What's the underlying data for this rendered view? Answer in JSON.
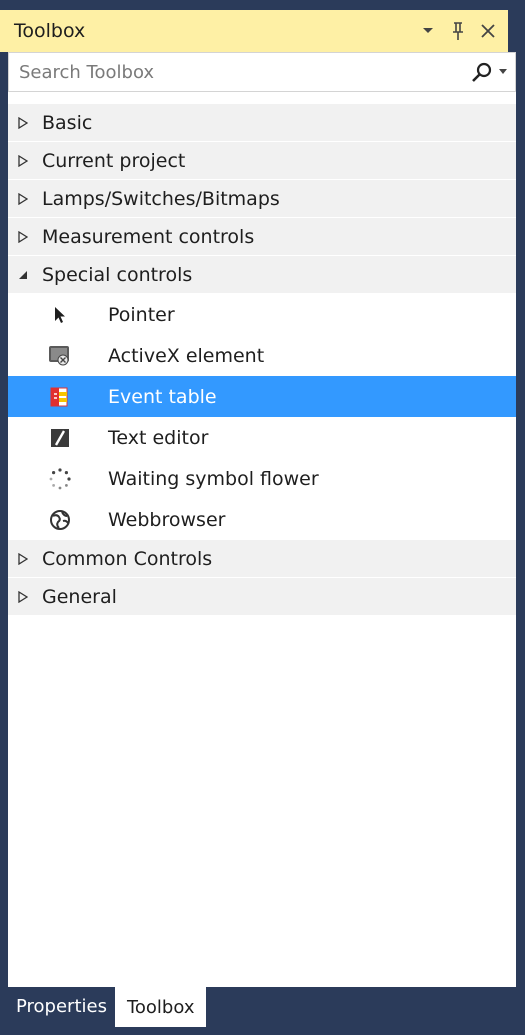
{
  "window": {
    "title": "Toolbox",
    "controls": [
      "dropdown-icon",
      "pin-icon",
      "close-icon"
    ]
  },
  "search": {
    "placeholder": "Search Toolbox"
  },
  "groups": [
    {
      "label": "Basic",
      "expanded": false
    },
    {
      "label": "Current project",
      "expanded": false
    },
    {
      "label": "Lamps/Switches/Bitmaps",
      "expanded": false
    },
    {
      "label": "Measurement controls",
      "expanded": false
    },
    {
      "label": "Special controls",
      "expanded": true,
      "items": [
        {
          "label": "Pointer",
          "icon": "pointer-icon"
        },
        {
          "label": "ActiveX element",
          "icon": "activex-icon"
        },
        {
          "label": "Event table",
          "icon": "event-table-icon",
          "selected": true
        },
        {
          "label": "Text editor",
          "icon": "text-editor-icon"
        },
        {
          "label": "Waiting symbol flower",
          "icon": "waiting-flower-icon"
        },
        {
          "label": "Webbrowser",
          "icon": "webbrowser-icon"
        }
      ]
    },
    {
      "label": "Common Controls",
      "expanded": false
    },
    {
      "label": "General",
      "expanded": false
    }
  ],
  "tabs": [
    {
      "label": "Properties",
      "active": false
    },
    {
      "label": "Toolbox",
      "active": true
    }
  ],
  "colors": {
    "title_bg": "#fef0a5",
    "selection": "#3399ff",
    "frame": "#2b3b5a"
  }
}
